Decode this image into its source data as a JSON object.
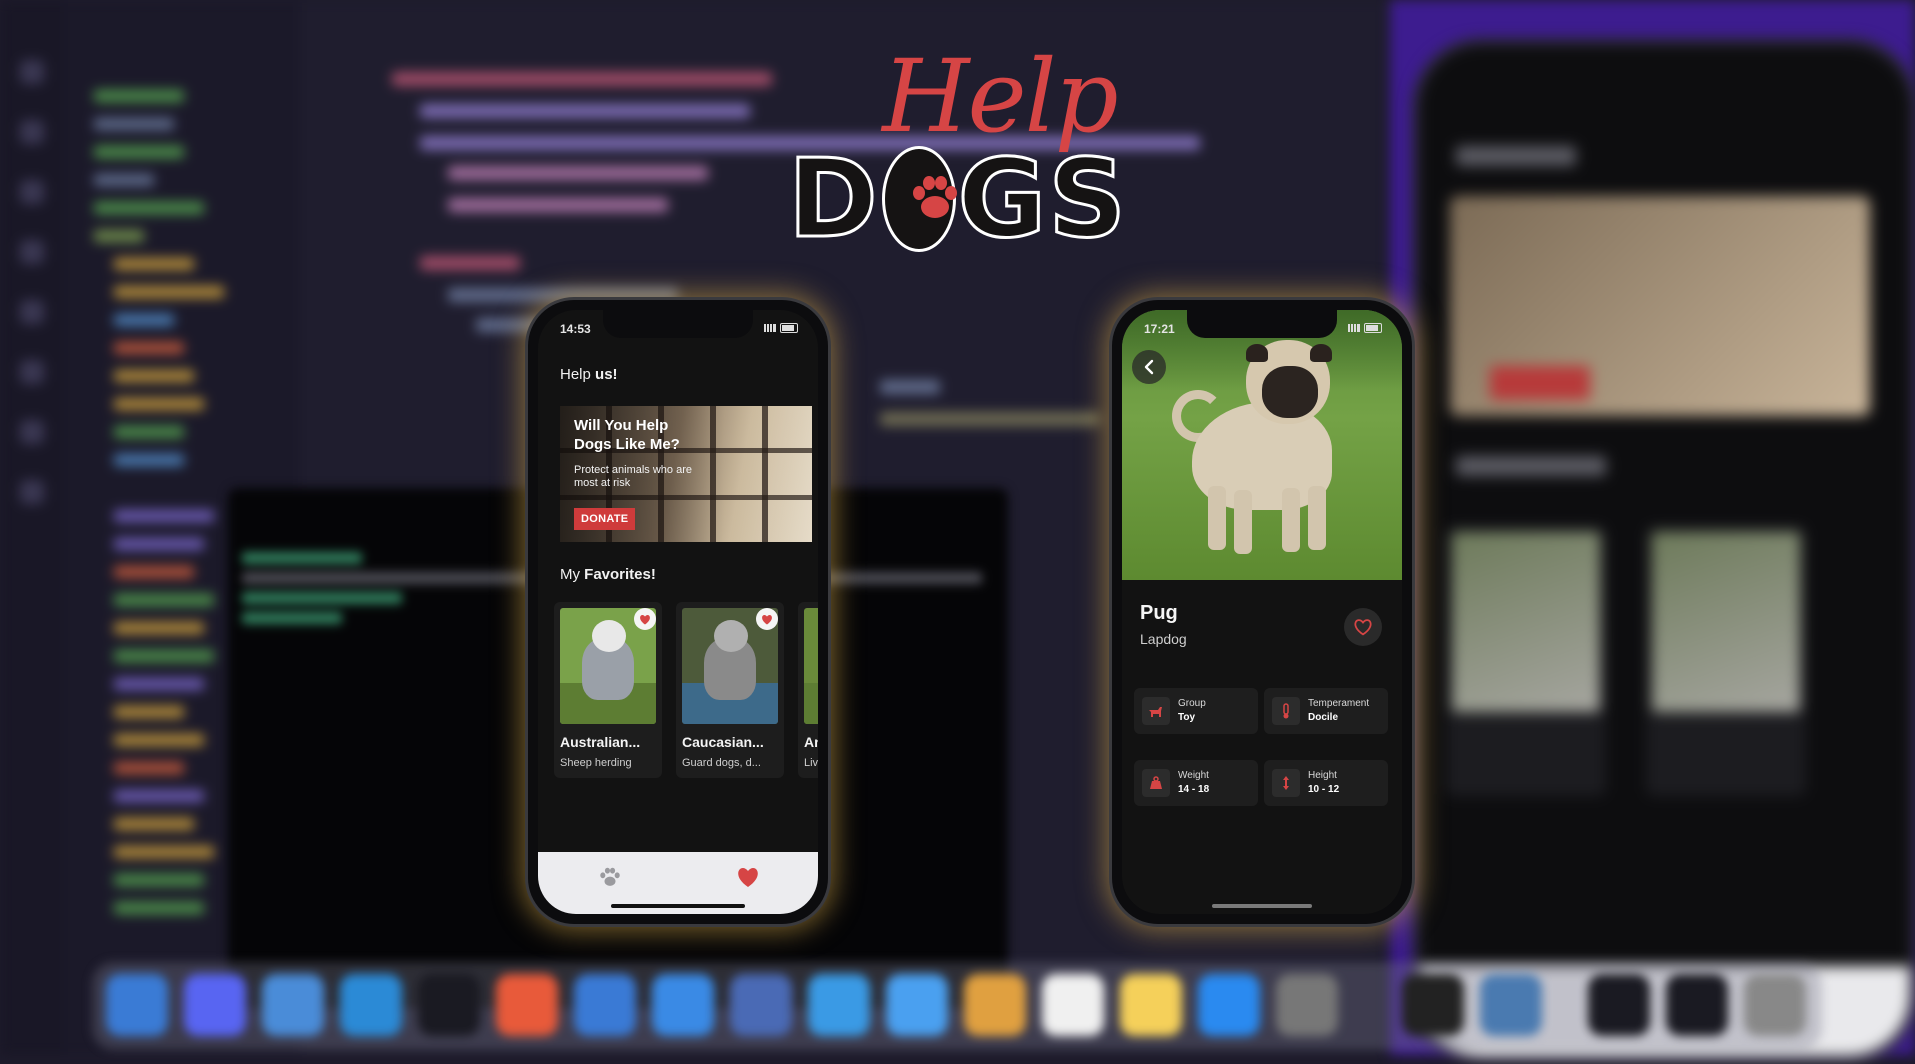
{
  "logo": {
    "line1": "Help",
    "line2_left": "D",
    "line2_right": "GS"
  },
  "colors": {
    "accent": "#d64545",
    "phone_bg": "#121212",
    "card_bg": "#1d1d1d",
    "tabbar_bg": "#ececef"
  },
  "phone_list": {
    "status_time": "14:53",
    "title_plain": "Help ",
    "title_bold": "us!",
    "banner": {
      "heading": "Will You Help Dogs Like Me?",
      "subtitle": "Protect animals who are most at risk",
      "button": "DONATE"
    },
    "favorites_plain": "My ",
    "favorites_bold": "Favorites!",
    "cards": [
      {
        "name": "Australian...",
        "sub": "Sheep herding",
        "icon": "heart-icon"
      },
      {
        "name": "Caucasian...",
        "sub": "Guard dogs, d...",
        "icon": "heart-icon"
      },
      {
        "name": "Ana",
        "sub": "Live",
        "icon": "heart-icon"
      }
    ],
    "tabs": [
      {
        "icon": "paw-icon"
      },
      {
        "icon": "heart-icon"
      }
    ]
  },
  "phone_detail": {
    "status_time": "17:21",
    "name": "Pug",
    "type": "Lapdog",
    "icons": {
      "back": "chevron-left-icon",
      "like": "heart-outline-icon"
    },
    "stats": [
      {
        "label": "Group",
        "value": "Toy",
        "icon": "dog-icon"
      },
      {
        "label": "Temperament",
        "value": "Docile",
        "icon": "thermometer-icon"
      },
      {
        "label": "Weight",
        "value": "14 - 18",
        "icon": "weight-icon"
      },
      {
        "label": "Height",
        "value": "10 - 12",
        "icon": "height-icon"
      }
    ]
  }
}
